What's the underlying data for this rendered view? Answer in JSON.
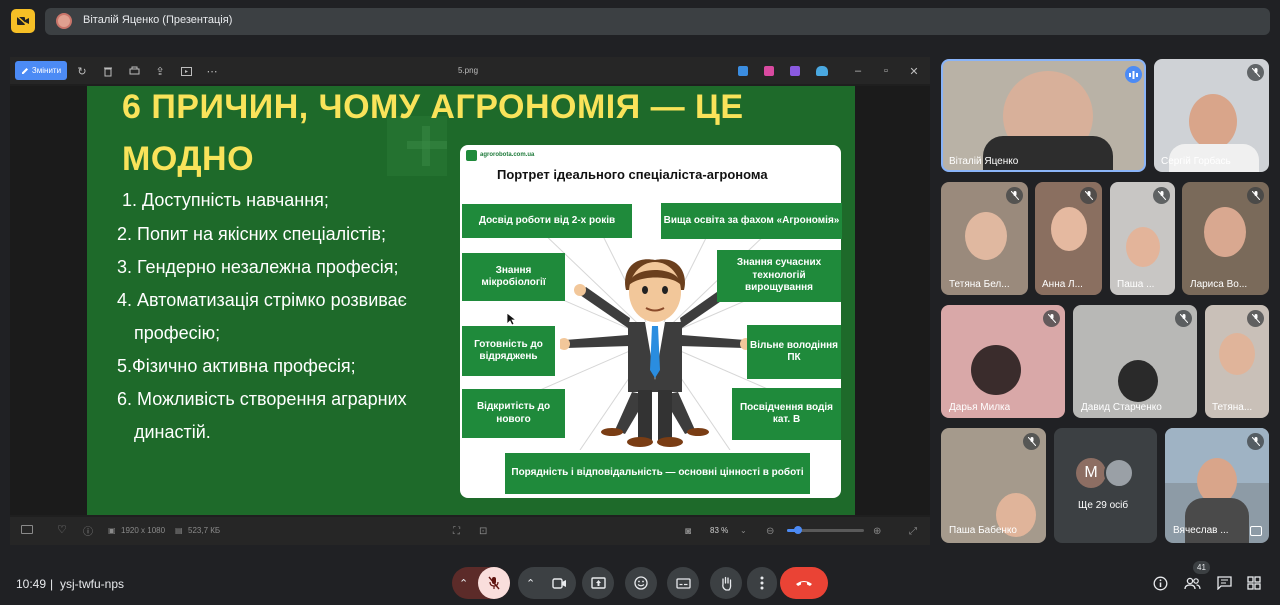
{
  "presenter_bar": {
    "title": "Віталій Яценко (Презентація)"
  },
  "viewer": {
    "edit_label": "Змінити",
    "file_name": "5.png",
    "dimensions": "1920 x 1080",
    "file_size": "523,7 КБ",
    "zoom": "83 %"
  },
  "slide": {
    "title_line1": "6 ПРИЧИН, ЧОМУ АГРОНОМІЯ — ЦЕ",
    "title_line2": "МОДНО",
    "reasons": [
      "1. Доступність навчання;",
      "2. Попит на якісних спеціалістів;",
      "3. Гендерно незалежна професія;",
      "4. Автоматизація стрімко розвиває",
      "професію;",
      "5.Фізично активна професія;",
      "6. Можливість створення аграрних",
      "династій."
    ],
    "infographic": {
      "site": "agrorobota.com.ua",
      "title": "Портрет ідеального спеціаліста-агронома",
      "boxes": [
        "Досвід роботи від 2-х років",
        "Вища освіта за фахом «Агрономія»",
        "Знання мікробіології",
        "Знання сучасних технологій вирощування",
        "Готовність до відряджень",
        "Вільне володіння ПК",
        "Відкритість до нового",
        "Посвідчення водія кат. В",
        "Порядність і відповідальність — основні цінності в роботі"
      ]
    }
  },
  "participants": [
    {
      "name": "Віталій Яценко",
      "bg": "#b9b2a6",
      "speaking": true
    },
    {
      "name": "Сергій Горбась",
      "bg": "#cfd2d6"
    },
    {
      "name": "Тетяна Бел...",
      "bg": "#9a8a7c"
    },
    {
      "name": "Анна Л...",
      "bg": "#8a6f60"
    },
    {
      "name": "Паша ...",
      "bg": "#c8c6c4"
    },
    {
      "name": "Лариса Во...",
      "bg": "#7a6a5a"
    },
    {
      "name": "Дарья Милка",
      "bg": "#d9a8a8"
    },
    {
      "name": "Давид Старченко",
      "bg": "#b8b8b6"
    },
    {
      "name": "Тетяна...",
      "bg": "#c9c0b8"
    },
    {
      "name": "Паша Бабенко",
      "bg": "#a59a8c"
    },
    {
      "name": "Ще 29 осіб",
      "bg": "#3c4043",
      "avatar_letter": "М"
    },
    {
      "name": "Вячеслав ...",
      "bg": "#8d9ba6"
    }
  ],
  "footer": {
    "time": "10:49",
    "meeting_code": "ysj-twfu-nps",
    "people_count": "41"
  },
  "colors": {
    "hangup": "#ea4335",
    "mic_off_bg": "#f9dedc",
    "accent_blue": "#4c8bf5",
    "slide_green": "#1e6a2a",
    "title_yellow": "#f9e35a"
  }
}
